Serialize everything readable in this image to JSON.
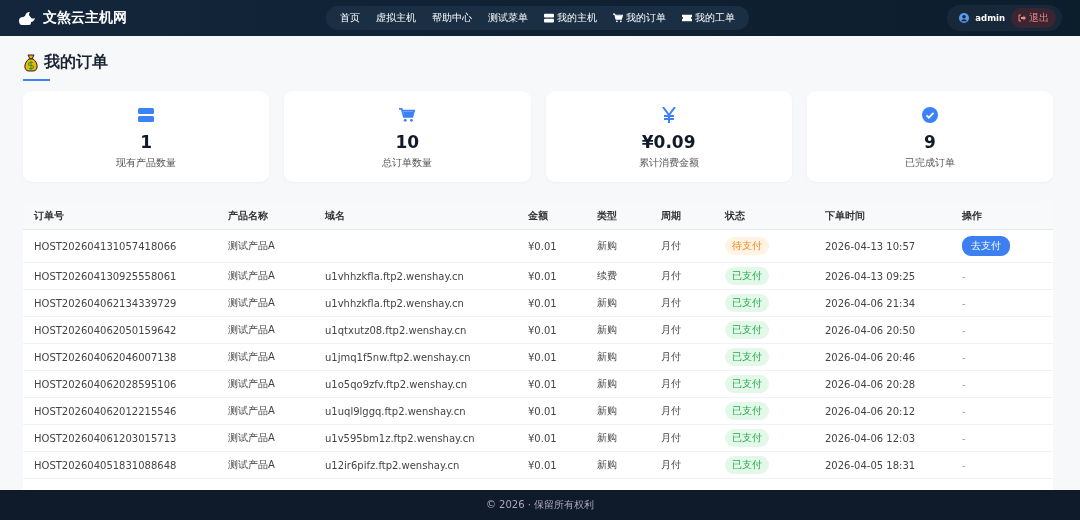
{
  "brand": {
    "name": "文煞云主机网"
  },
  "nav": [
    {
      "label": "首页"
    },
    {
      "label": "虚拟主机"
    },
    {
      "label": "帮助中心"
    },
    {
      "label": "测试菜单"
    },
    {
      "label": "我的主机"
    },
    {
      "label": "我的订单"
    },
    {
      "label": "我的工单"
    }
  ],
  "user": {
    "name": "admin",
    "logout": "退出"
  },
  "page_title": "我的订单",
  "stats": [
    {
      "value": "1",
      "label": "现有产品数量"
    },
    {
      "value": "10",
      "label": "总订单数量"
    },
    {
      "value": "¥0.09",
      "label": "累计消费金额"
    },
    {
      "value": "9",
      "label": "已完成订单"
    }
  ],
  "table": {
    "columns": [
      "订单号",
      "产品名称",
      "域名",
      "金额",
      "类型",
      "周期",
      "状态",
      "下单时间",
      "操作"
    ],
    "rows": [
      {
        "order": "HOST202604131057418066",
        "product": "测试产品A",
        "domain": "",
        "amount": "¥0.01",
        "type": "新购",
        "period": "月付",
        "status": {
          "kind": "pending",
          "label": "待支付"
        },
        "time": "2026-04-13 10:57",
        "action": {
          "kind": "button",
          "label": "去支付"
        }
      },
      {
        "order": "HOST202604130925558061",
        "product": "测试产品A",
        "domain": "u1vhhzkfla.ftp2.wenshay.cn",
        "amount": "¥0.01",
        "type": "续费",
        "period": "月付",
        "status": {
          "kind": "paid",
          "label": "已支付"
        },
        "time": "2026-04-13 09:25",
        "action": {
          "kind": "text",
          "label": "-"
        }
      },
      {
        "order": "HOST202604062134339729",
        "product": "测试产品A",
        "domain": "u1vhhzkfla.ftp2.wenshay.cn",
        "amount": "¥0.01",
        "type": "新购",
        "period": "月付",
        "status": {
          "kind": "paid",
          "label": "已支付"
        },
        "time": "2026-04-06 21:34",
        "action": {
          "kind": "text",
          "label": "-"
        }
      },
      {
        "order": "HOST202604062050159642",
        "product": "测试产品A",
        "domain": "u1qtxutz08.ftp2.wenshay.cn",
        "amount": "¥0.01",
        "type": "新购",
        "period": "月付",
        "status": {
          "kind": "paid",
          "label": "已支付"
        },
        "time": "2026-04-06 20:50",
        "action": {
          "kind": "text",
          "label": "-"
        }
      },
      {
        "order": "HOST202604062046007138",
        "product": "测试产品A",
        "domain": "u1jmq1f5nw.ftp2.wenshay.cn",
        "amount": "¥0.01",
        "type": "新购",
        "period": "月付",
        "status": {
          "kind": "paid",
          "label": "已支付"
        },
        "time": "2026-04-06 20:46",
        "action": {
          "kind": "text",
          "label": "-"
        }
      },
      {
        "order": "HOST202604062028595106",
        "product": "测试产品A",
        "domain": "u1o5qo9zfv.ftp2.wenshay.cn",
        "amount": "¥0.01",
        "type": "新购",
        "period": "月付",
        "status": {
          "kind": "paid",
          "label": "已支付"
        },
        "time": "2026-04-06 20:28",
        "action": {
          "kind": "text",
          "label": "-"
        }
      },
      {
        "order": "HOST202604062012215546",
        "product": "测试产品A",
        "domain": "u1uql9lggq.ftp2.wenshay.cn",
        "amount": "¥0.01",
        "type": "新购",
        "period": "月付",
        "status": {
          "kind": "paid",
          "label": "已支付"
        },
        "time": "2026-04-06 20:12",
        "action": {
          "kind": "text",
          "label": "-"
        }
      },
      {
        "order": "HOST202604061203015713",
        "product": "测试产品A",
        "domain": "u1v595bm1z.ftp2.wenshay.cn",
        "amount": "¥0.01",
        "type": "新购",
        "period": "月付",
        "status": {
          "kind": "paid",
          "label": "已支付"
        },
        "time": "2026-04-06 12:03",
        "action": {
          "kind": "text",
          "label": "-"
        }
      },
      {
        "order": "HOST202604051831088648",
        "product": "测试产品A",
        "domain": "u12ir6pifz.ftp2.wenshay.cn",
        "amount": "¥0.01",
        "type": "新购",
        "period": "月付",
        "status": {
          "kind": "paid",
          "label": "已支付"
        },
        "time": "2026-04-05 18:31",
        "action": {
          "kind": "text",
          "label": "-"
        }
      }
    ]
  },
  "footer": "© 2026 · 保留所有权利"
}
